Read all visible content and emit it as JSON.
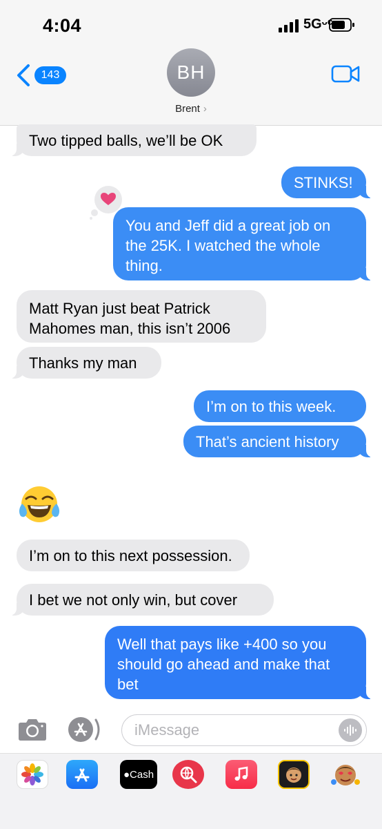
{
  "status": {
    "time": "4:04",
    "network": "5Gᵕᶜ"
  },
  "header": {
    "back_count": "143",
    "avatar_initials": "BH",
    "contact_name": "Brent",
    "name_chevron": "›"
  },
  "messages": {
    "m1": "Two tipped balls, we’ll be OK",
    "m2": "STINKS!",
    "m3_l1": "You and Jeff did a great job on",
    "m3_l2": "the 25K. I watched the whole",
    "m3_l3": "thing.",
    "m4_l1": "Matt Ryan just beat Patrick",
    "m4_l2": "Mahomes man, this isn’t 2006",
    "m5": "Thanks my man",
    "m6": "I’m on to this week.",
    "m7": "That’s ancient history",
    "m8_emoji": "face-with-tears-of-joy",
    "m9": "I’m on to this next possession.",
    "m10": "I bet we not only win, but cover",
    "m11_l1": "Well that pays like +400 so you",
    "m11_l2": "should go ahead and make that",
    "m11_l3": "bet"
  },
  "tapback": {
    "reaction": "heart",
    "color": "#e8457a"
  },
  "input": {
    "placeholder": "iMessage"
  },
  "app_strip": {
    "cash_label": "Cash"
  },
  "colors": {
    "ios_blue": "#0a84ff",
    "incoming_bubble": "#e9e9eb",
    "outgoing_bubble": "#3b8df5"
  }
}
